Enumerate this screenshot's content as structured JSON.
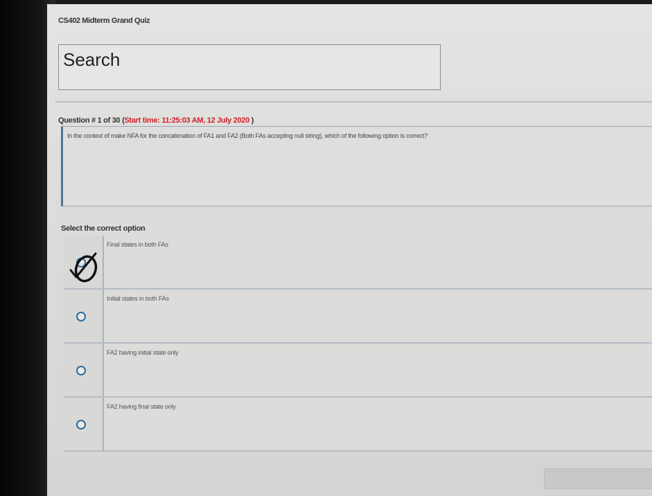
{
  "header": {
    "title": "CS402 Midterm Grand Quiz"
  },
  "search": {
    "label": "Search"
  },
  "question": {
    "number_text": "Question # 1 of 30 (",
    "time_text": "Start time: 11:25:03 AM, 12 July 2020",
    "close_paren": " )",
    "text": "In the context of make NFA for the concatenation of FA1 and FA2 (Both FAs accepting null string), which of the following option is correct?"
  },
  "options_section": {
    "label": "Select the correct option",
    "options": [
      {
        "label": "Final states in both FAs",
        "selected": true
      },
      {
        "label": "Initial states in both FAs",
        "selected": false
      },
      {
        "label": "FA2 having initial state only",
        "selected": false
      },
      {
        "label": "FA2 having final state only",
        "selected": false
      }
    ]
  },
  "colors": {
    "accent_blue": "#2c6c9c",
    "time_red": "#d2202a"
  }
}
